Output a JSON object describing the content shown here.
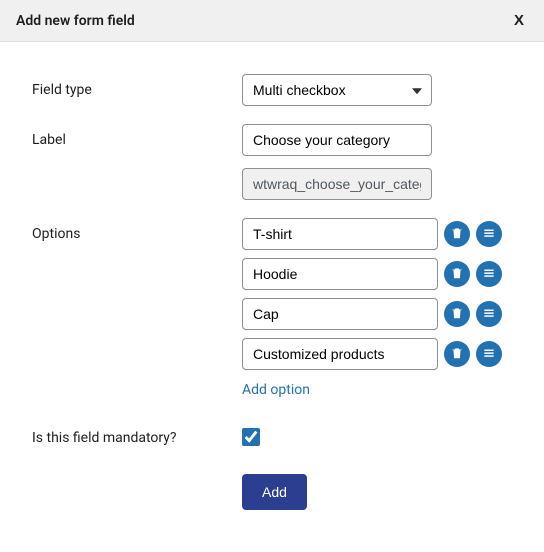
{
  "header": {
    "title": "Add new form field",
    "close": "X"
  },
  "labels": {
    "field_type": "Field type",
    "label": "Label",
    "options": "Options",
    "mandatory": "Is this field mandatory?"
  },
  "field_type": {
    "selected": "Multi checkbox"
  },
  "label_field": {
    "value": "Choose your category",
    "slug": "wtwraq_choose_your_category"
  },
  "options": [
    {
      "value": "T-shirt"
    },
    {
      "value": "Hoodie"
    },
    {
      "value": "Cap"
    },
    {
      "value": "Customized products"
    }
  ],
  "add_option_label": "Add option",
  "mandatory_checked": true,
  "submit_label": "Add"
}
